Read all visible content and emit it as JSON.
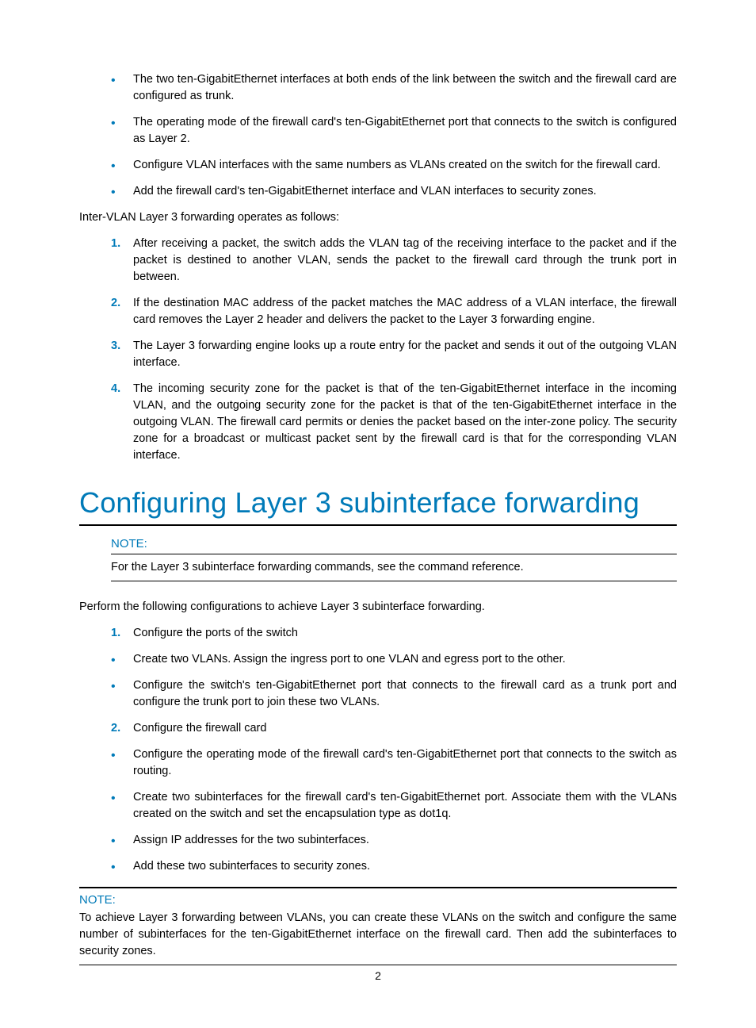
{
  "top_bullets": [
    "The two ten-GigabitEthernet interfaces at both ends of the link between the switch and the firewall card are configured as trunk.",
    "The operating mode of the firewall card's ten-GigabitEthernet port that connects to the switch is configured as Layer 2.",
    "Configure VLAN interfaces with the same numbers as VLANs created on the switch for the firewall card.",
    "Add the firewall card's ten-GigabitEthernet interface and VLAN interfaces to security zones."
  ],
  "inter_vlan_intro": "Inter-VLAN Layer 3 forwarding operates as follows:",
  "inter_vlan_steps": [
    "After receiving a packet, the switch adds the VLAN tag of the receiving interface to the packet and if the packet is destined to another VLAN, sends the packet to the firewall card through the trunk port in between.",
    "If the destination MAC address of the packet matches the MAC address of a VLAN interface, the firewall card removes the Layer 2 header and delivers the packet to the Layer 3 forwarding engine.",
    "The Layer 3 forwarding engine looks up a route entry for the packet and sends it out of the outgoing VLAN interface.",
    "The incoming security zone for the packet is that of the ten-GigabitEthernet interface in the incoming VLAN, and the outgoing security zone for the packet is that of the ten-GigabitEthernet interface in the outgoing VLAN. The firewall card permits or denies the packet based on the inter-zone policy. The security zone for a broadcast or multicast packet sent by the firewall card is that for the corresponding VLAN interface."
  ],
  "section_heading": "Configuring Layer 3 subinterface forwarding",
  "note1": {
    "label": "NOTE:",
    "text": "For the Layer 3 subinterface forwarding commands, see the command reference."
  },
  "perform_intro": "Perform the following configurations to achieve Layer 3 subinterface forwarding.",
  "step1": {
    "num": "1.",
    "text": "Configure the ports of the switch"
  },
  "step1_bullets": [
    "Create two VLANs. Assign the ingress port to one VLAN and egress port to the other.",
    "Configure the switch's ten-GigabitEthernet port that connects to the firewall card as a trunk port and configure the trunk port to join these two VLANs."
  ],
  "step2": {
    "num": "2.",
    "text": "Configure the firewall card"
  },
  "step2_bullets": [
    "Configure the operating mode of the firewall card's ten-GigabitEthernet port that connects to the switch as routing.",
    "Create two subinterfaces for the firewall card's ten-GigabitEthernet port. Associate them with the VLANs created on the switch and set the encapsulation type as dot1q.",
    "Assign IP addresses for the two subinterfaces.",
    "Add these two subinterfaces to security zones."
  ],
  "note2": {
    "label": "NOTE:",
    "text": "To achieve Layer 3 forwarding between VLANs, you can create these VLANs on the switch and configure the same number of subinterfaces for the ten-GigabitEthernet interface on the firewall card. Then add the subinterfaces to security zones."
  },
  "page_number": "2"
}
